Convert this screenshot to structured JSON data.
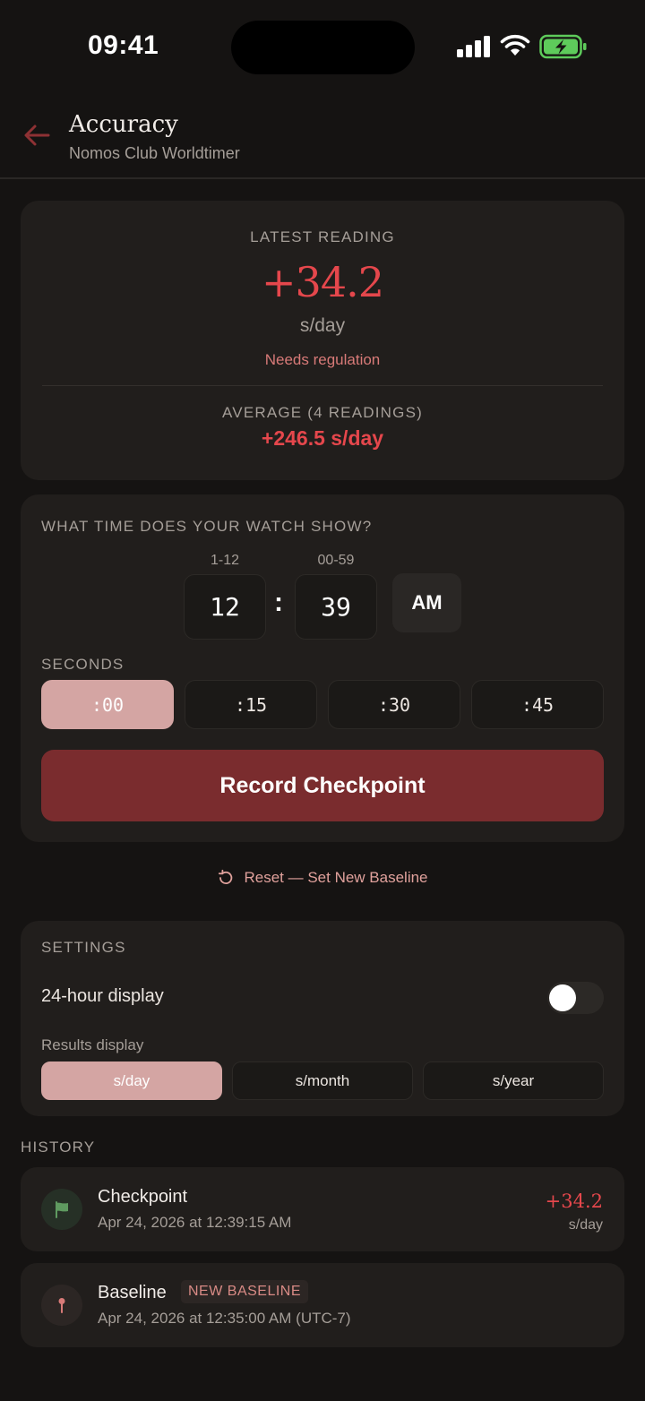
{
  "status_bar": {
    "time": "09:41",
    "icons": [
      "signal-icon",
      "wifi-icon",
      "battery-charging-icon"
    ]
  },
  "header": {
    "title": "Accuracy",
    "subtitle": "Nomos Club Worldtimer",
    "back_icon": "arrow-left-icon"
  },
  "reading": {
    "label": "LATEST READING",
    "value": "+34.2",
    "unit": "s/day",
    "status": "Needs regulation",
    "average_label": "AVERAGE (4 READINGS)",
    "average_value": "+246.5 s/day"
  },
  "time_entry": {
    "question": "WHAT TIME DOES YOUR WATCH SHOW?",
    "hour_range": "1-12",
    "minute_range": "00-59",
    "hour": "12",
    "separator": ":",
    "minute": "39",
    "period": "AM",
    "seconds_label": "SECONDS",
    "seconds_options": [
      ":00",
      ":15",
      ":30",
      ":45"
    ],
    "seconds_selected": ":00",
    "record_label": "Record Checkpoint"
  },
  "reset": {
    "label": "Reset — Set New Baseline",
    "icon": "rotate-ccw-icon"
  },
  "settings": {
    "label": "SETTINGS",
    "toggle_24h_label": "24-hour display",
    "toggle_24h_on": false,
    "results_label": "Results display",
    "results_options": [
      "s/day",
      "s/month",
      "s/year"
    ],
    "results_selected": "s/day"
  },
  "history": {
    "label": "HISTORY",
    "items": [
      {
        "title": "Checkpoint",
        "time": "Apr 24, 2026 at 12:39:15 AM",
        "value": "+34.2",
        "unit": "s/day",
        "icon": "flag-icon"
      },
      {
        "title": "Baseline",
        "badge": "NEW BASELINE",
        "time": "Apr 24, 2026 at 12:35:00 AM (UTC-7)",
        "icon": "pin-icon"
      }
    ]
  },
  "colors": {
    "background": "#151312",
    "card": "#211e1c",
    "accent_red": "#e5474c",
    "primary_button": "#7a2c2e",
    "selected_chip": "#d4a5a3",
    "flag_green": "#5f9a60"
  }
}
